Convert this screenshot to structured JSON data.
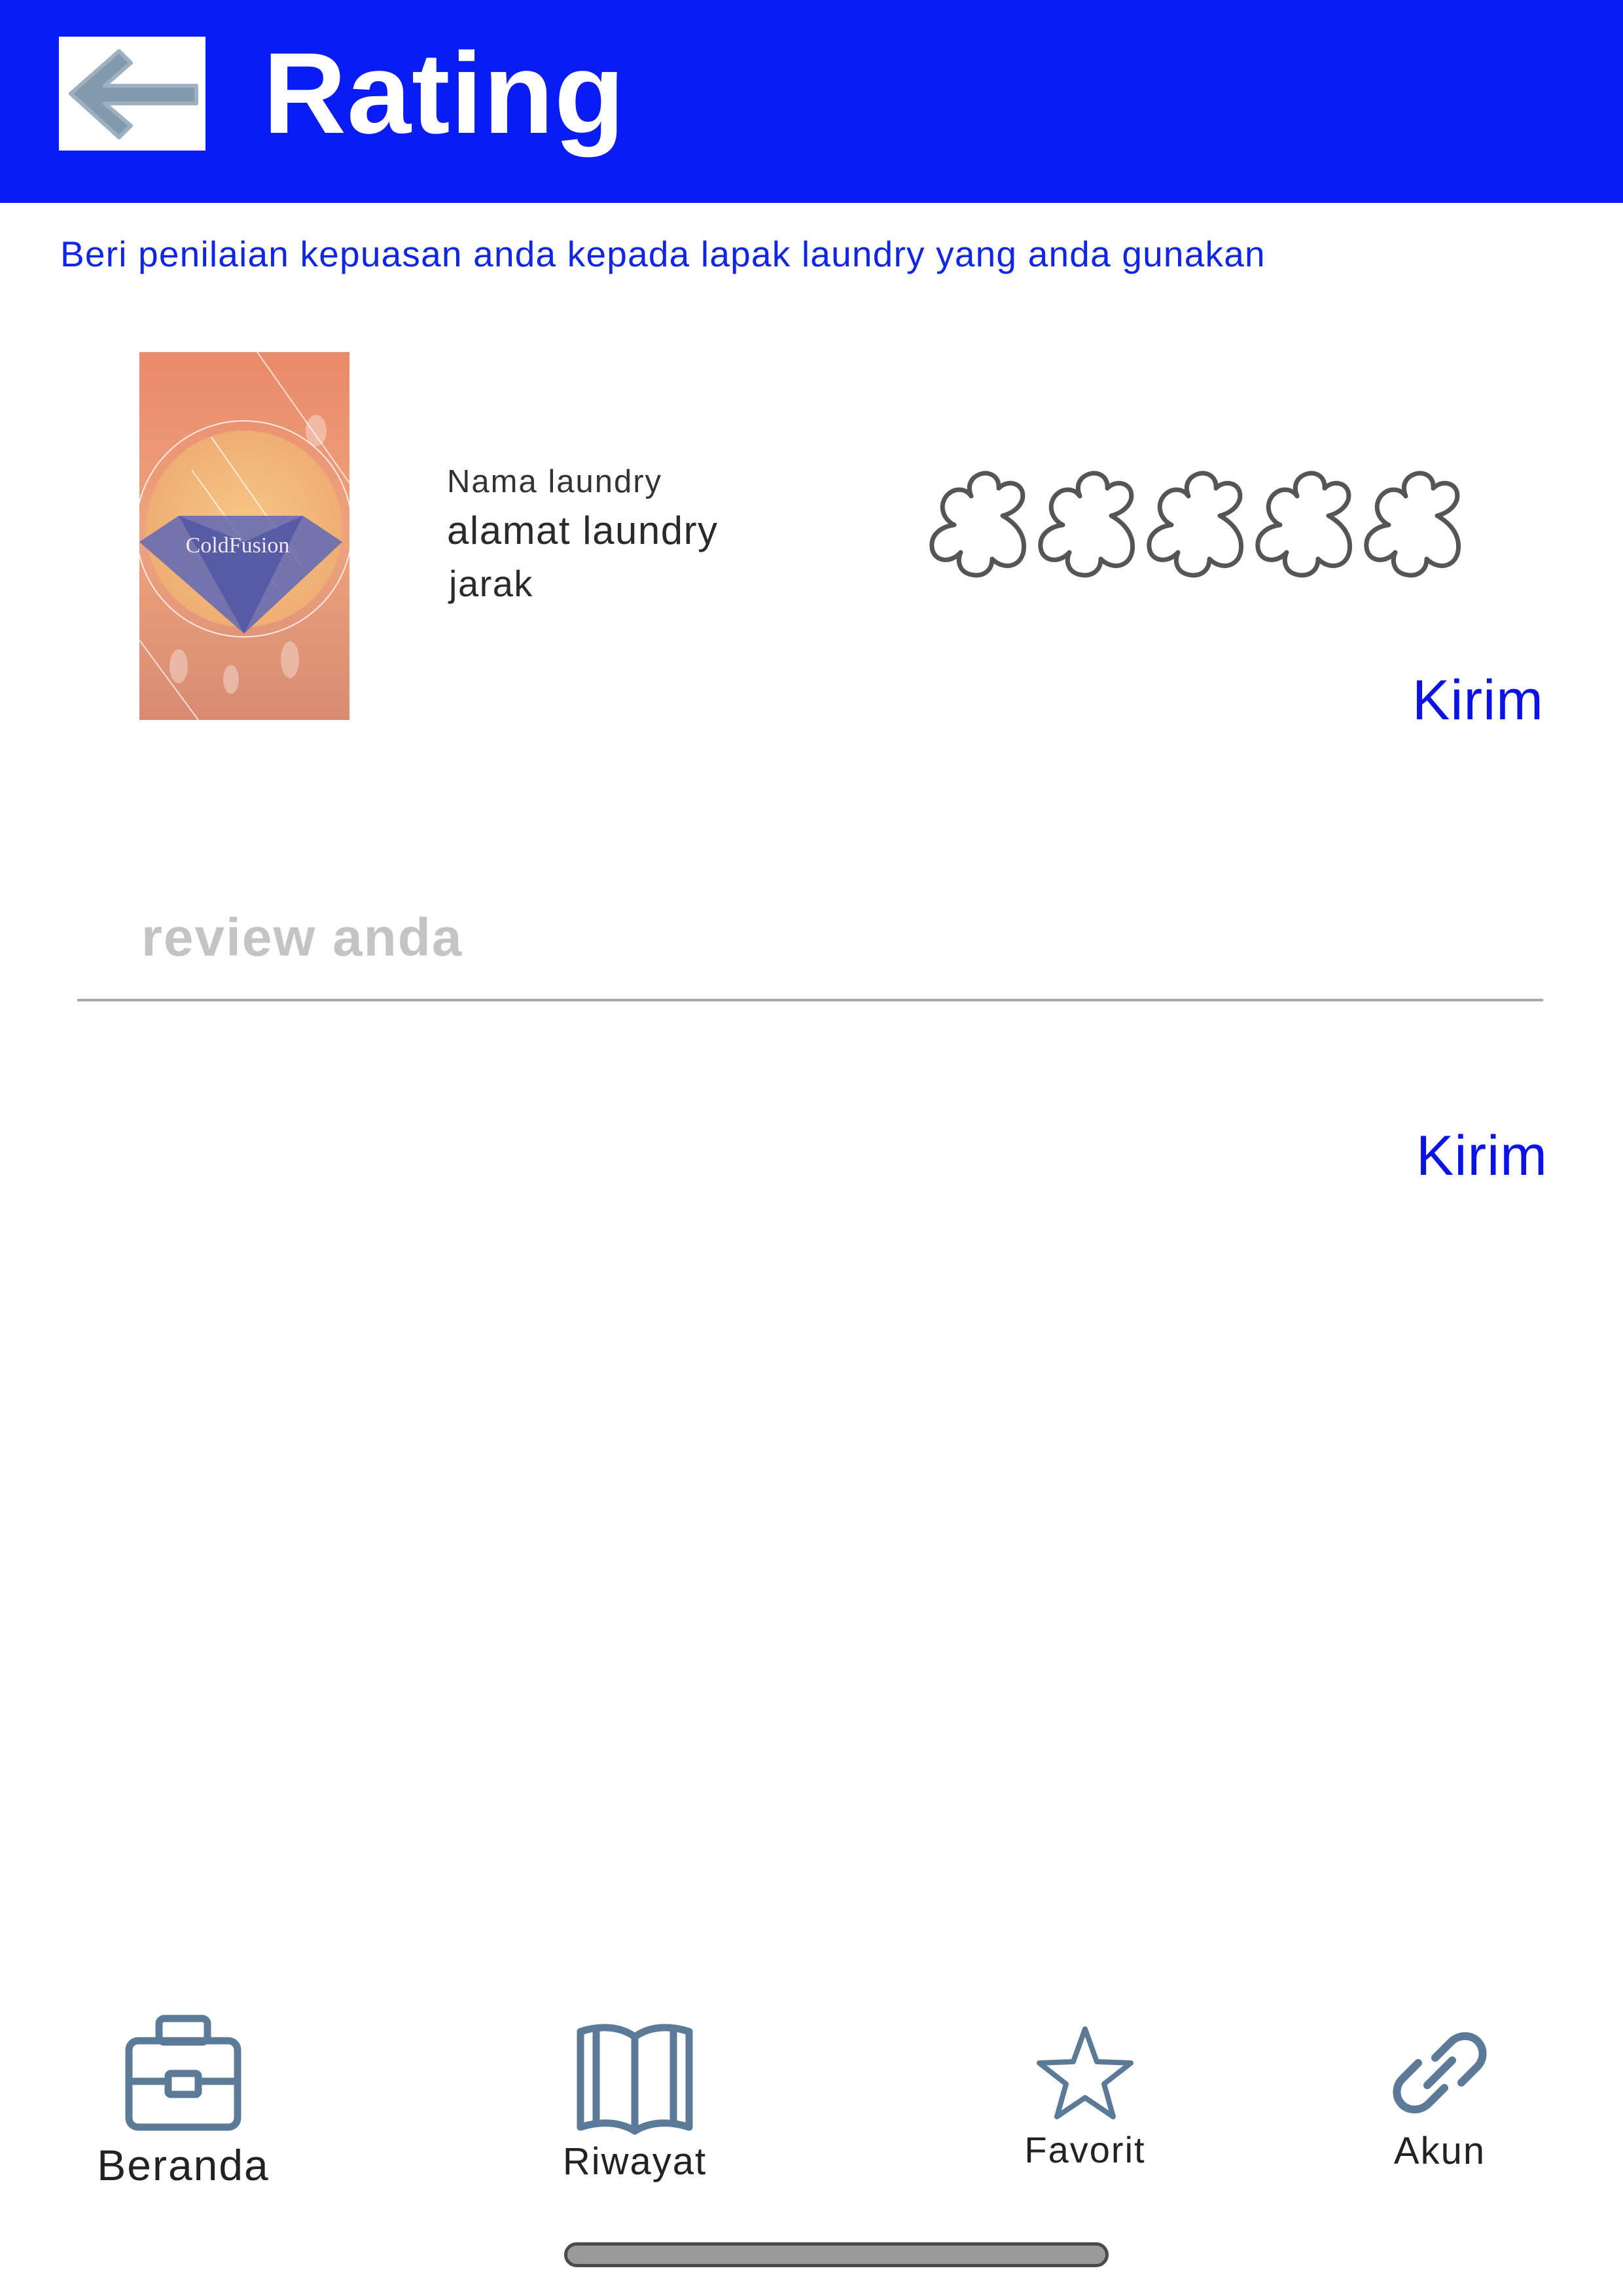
{
  "header": {
    "title": "Rating",
    "back_icon": "arrow-left-icon",
    "background_color": "#0a1cf6"
  },
  "subtitle": "Beri penilaian kepuasan anda kepada lapak laundry yang anda gunakan",
  "laundry": {
    "thumbnail_text": "ColdFusion",
    "name": "Nama laundry",
    "address": "alamat laundry",
    "distance": "jarak"
  },
  "rating": {
    "max": 5,
    "selected": 0,
    "icon": "star-outline-icon"
  },
  "actions": {
    "submit_rating_label": "Kirim",
    "submit_review_label": "Kirim"
  },
  "review": {
    "placeholder": "review anda",
    "value": ""
  },
  "bottom_nav": {
    "items": [
      {
        "label": "Beranda",
        "icon": "briefcase-icon"
      },
      {
        "label": "Riwayat",
        "icon": "book-icon"
      },
      {
        "label": "Favorit",
        "icon": "star-icon"
      },
      {
        "label": "Akun",
        "icon": "link-icon"
      }
    ]
  },
  "colors": {
    "accent": "#0a1cf6",
    "link_text": "#0a12e6",
    "nav_icon": "#5b7a97"
  }
}
